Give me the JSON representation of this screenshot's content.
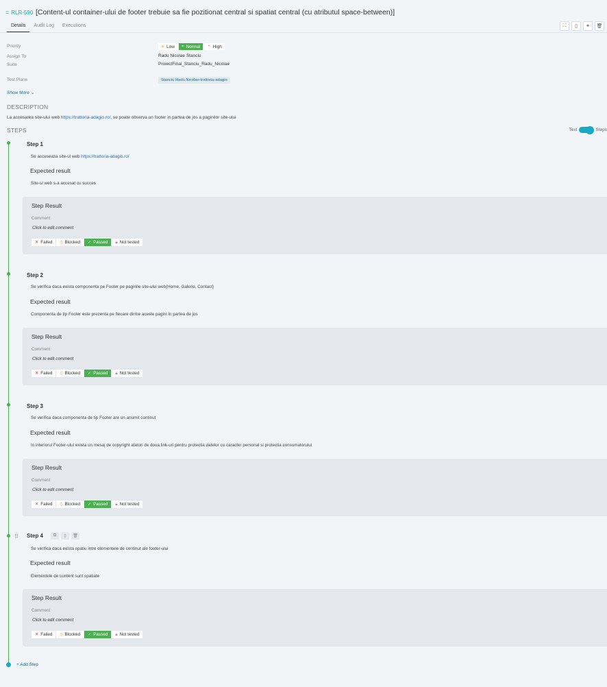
{
  "header": {
    "issue_key": "RLR-590",
    "title": "[Content-ul container-ului de footer trebuie sa fie pozitionat central si spatiat central (cu atributul space-between)]",
    "tabs": [
      {
        "label": "Details"
      },
      {
        "label": "Audit Log"
      },
      {
        "label": "Executions"
      }
    ]
  },
  "fields": {
    "priority_label": "Priority",
    "priority_options": [
      {
        "label": "Low",
        "selected": false
      },
      {
        "label": "Normal",
        "selected": true
      },
      {
        "label": "High",
        "selected": false
      }
    ],
    "assign_label": "Assign To",
    "assign_value": "Radu Nicolae Stanciu",
    "suite_label": "Suite",
    "suite_value": "ProiectFinal_Stanciu_Radu_Nicolae",
    "test_plans_label": "Test Plans",
    "test_plan_chip": "Stanciu Radu Nicolae-trattoria-adagio",
    "show_more": "Show More"
  },
  "description": {
    "heading": "DESCRIPTION",
    "text_before": "La accesarea site-ului web ",
    "link": "https://trattoria-adagio.ro/",
    "text_after": ", se poate observa un footer in partea de jos a paginilor site-ului"
  },
  "steps_section": {
    "heading": "STEPS",
    "toggle_left": "Text",
    "toggle_right": "Steps",
    "add_step": "+ Add Step"
  },
  "steps": [
    {
      "title": "Step 1",
      "action_before": "Se acceseaza site-ul web ",
      "action_link": "https://trattoria-adagio.ro/",
      "expected_label": "Expected result",
      "expected": "Site-ul web s-a accesat cu succes"
    },
    {
      "title": "Step 2",
      "action_before": "Se verifica daca exista componenta pe Footer pe paginile site-ului web(Home, Galerie, Contact)",
      "action_link": "",
      "expected_label": "Expected result",
      "expected": "Componenta de tip Footer este prezenta pe fiecare dintre aceste pagini in partea de jos"
    },
    {
      "title": "Step 3",
      "action_before": "Se verifica daca componenta de tip Footer are un anumit continut",
      "action_link": "",
      "expected_label": "Expected result",
      "expected": "In interiorul Footer-ului exista un mesaj de copyright alaturi de doua link-uri pentru protectia datelor cu caracter personal si protectia consumatorului"
    },
    {
      "title": "Step 4",
      "action_before": "Se verifica daca exista spatiu intre elementele de continut ale footer-ului",
      "action_link": "",
      "expected_label": "Expected result",
      "expected": "Elementele de content sunt spatiate"
    }
  ],
  "step_result": {
    "title": "Step Result",
    "comment_label": "Comment",
    "comment_placeholder": "Click to edit comment",
    "buttons": [
      {
        "label": "Failed",
        "icon": "close-icon"
      },
      {
        "label": "Blocked",
        "icon": "blocked-icon"
      },
      {
        "label": "Passed",
        "icon": "check-icon",
        "selected": true
      },
      {
        "label": "Not tested",
        "icon": "lock-icon"
      }
    ]
  },
  "colors": {
    "accent": "#18a999",
    "passed": "#4caf50",
    "link": "#2a6fb0",
    "toggle": "#18a9c4"
  }
}
